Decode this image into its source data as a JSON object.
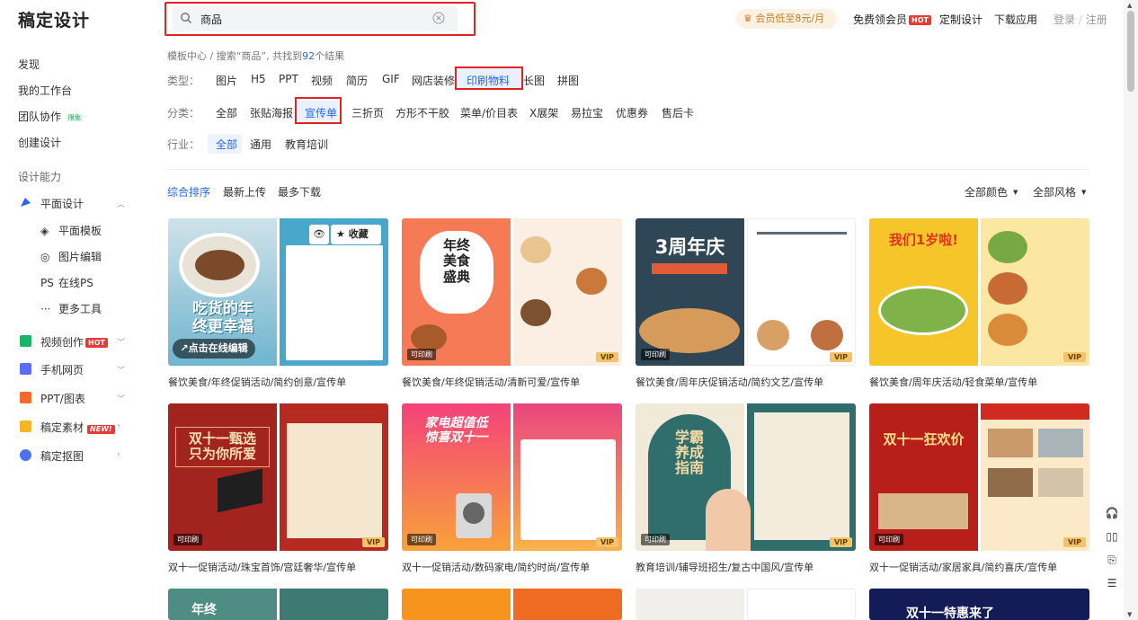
{
  "brand": {
    "logo": "稿定设计"
  },
  "search": {
    "value": "商品"
  },
  "header": {
    "vip_promo": "会员低至8元/月",
    "free_vip": "免费领会员",
    "free_vip_badge": "HOT",
    "custom_design": "定制设计",
    "download_app": "下载应用",
    "login": "登录",
    "separator": "/",
    "register": "注册"
  },
  "sidebar": {
    "discover": "发现",
    "my_workspace": "我的工作台",
    "team": "团队协作",
    "team_badge": "限免",
    "create": "创建设计",
    "section_title": "设计能力",
    "flat_design": "平面设计",
    "flat_sub": [
      {
        "glyph": "◈",
        "label": "平面模板"
      },
      {
        "glyph": "◎",
        "label": "图片编辑"
      },
      {
        "glyph": "PS",
        "label": "在线PS"
      },
      {
        "glyph": "···",
        "label": "更多工具"
      }
    ],
    "video": "视频创作",
    "video_badge": "HOT",
    "mobile": "手机网页",
    "ppt": "PPT/图表",
    "assets": "稿定素材",
    "assets_badge": "NEW!",
    "cutout": "稿定抠图"
  },
  "breadcrumb": {
    "prefix": "模板中心 / 搜索“商品”, 共找到",
    "count": "92",
    "suffix": "个结果"
  },
  "filters": {
    "type_label": "类型：",
    "types": [
      "图片",
      "H5",
      "PPT",
      "视频",
      "简历",
      "GIF",
      "网店装修",
      "印刷物料",
      "长图",
      "拼图"
    ],
    "category_label": "分类：",
    "categories": [
      "全部",
      "张贴海报",
      "宣传单",
      "三折页",
      "方形不干胶",
      "菜单/价目表",
      "X展架",
      "易拉宝",
      "优惠券",
      "售后卡"
    ],
    "industry_label": "行业：",
    "industries": [
      "全部",
      "通用",
      "教育培训"
    ]
  },
  "sort": {
    "options": [
      "综合排序",
      "最新上传",
      "最多下载"
    ],
    "color_filter": "全部颜色",
    "style_filter": "全部风格"
  },
  "card_actions": {
    "favorite": "收藏",
    "edit_online": "↗点击在线编辑",
    "print_tag": "可印刷",
    "vip_tag": "VIP"
  },
  "cards": [
    {
      "title": "餐饮美食/年终促销活动/简约创意/宣传单",
      "poster": "吃货的年\n终更幸福"
    },
    {
      "title": "餐饮美食/年终促销活动/清新可爱/宣传单",
      "poster": "年终\n美食\n盛典"
    },
    {
      "title": "餐饮美食/周年庆促销活动/简约文艺/宣传单",
      "poster": "3周年庆"
    },
    {
      "title": "餐饮美食/周年庆活动/轻食菜单/宣传单",
      "poster": "我们1岁啦!"
    },
    {
      "title": "双十一促销活动/珠宝首饰/宫廷奢华/宣传单",
      "poster": "双十一甄选\n只为你所爱"
    },
    {
      "title": "双十一促销活动/数码家电/简约时尚/宣传单",
      "poster": "家电超值低\n惊喜双十一"
    },
    {
      "title": "教育培训/辅导班招生/复古中国风/宣传单",
      "poster": "学霸养成指南"
    },
    {
      "title": "双十一促销活动/家居家具/简约喜庆/宣传单",
      "poster": "双十一狂欢价"
    },
    {
      "title": "",
      "poster": "年终"
    },
    {
      "title": "",
      "poster": ""
    },
    {
      "title": "",
      "poster": ""
    },
    {
      "title": "",
      "poster": "双十一特惠来了"
    }
  ],
  "colors": {
    "accent_blue": "#2468f2",
    "highlight_red": "#e02424",
    "hot_red": "#e63a32"
  }
}
